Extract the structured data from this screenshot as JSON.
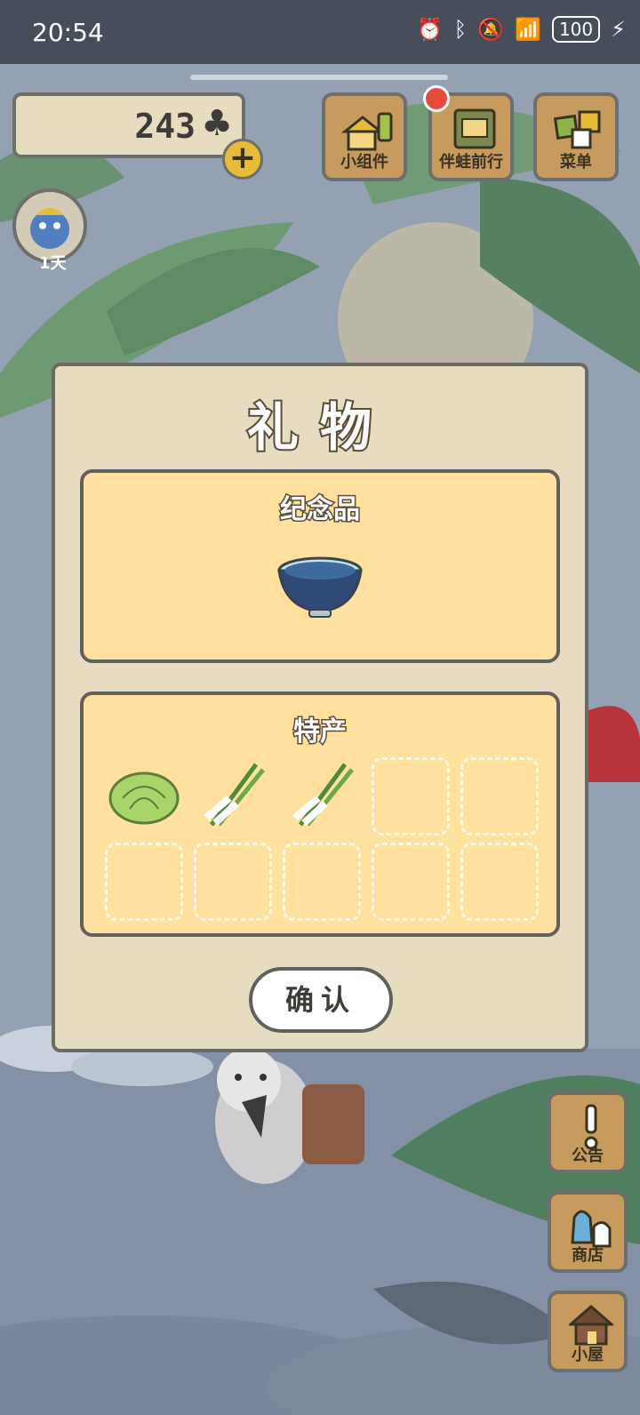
{
  "status_bar": {
    "time": "20:54",
    "battery": "100"
  },
  "currency": {
    "value": "243",
    "symbol": "♣"
  },
  "avatar": {
    "days_label": "1天"
  },
  "top_buttons": [
    {
      "label": "小组件",
      "icon": "widget-icon"
    },
    {
      "label": "伴蛙前行",
      "icon": "album-icon"
    },
    {
      "label": "菜单",
      "icon": "menu-icon"
    }
  ],
  "side_buttons": [
    {
      "label": "公告",
      "icon": "notice-icon"
    },
    {
      "label": "商店",
      "icon": "shop-icon"
    },
    {
      "label": "小屋",
      "icon": "house-icon"
    }
  ],
  "gift_dialog": {
    "title": "礼物",
    "souvenir_section": {
      "title": "纪念品",
      "items": [
        "bowl-icon"
      ]
    },
    "specialty_section": {
      "title": "特产",
      "items": [
        "cabbage-icon",
        "green-onion-icon",
        "green-onion-icon"
      ],
      "empty_slots": 7
    },
    "confirm_label": "确认"
  },
  "colors": {
    "panel_bg": "#ffe09e",
    "dialog_bg": "#e6dcc2",
    "button_wood": "#c79b5e",
    "accent_gold": "#e7bc39"
  }
}
